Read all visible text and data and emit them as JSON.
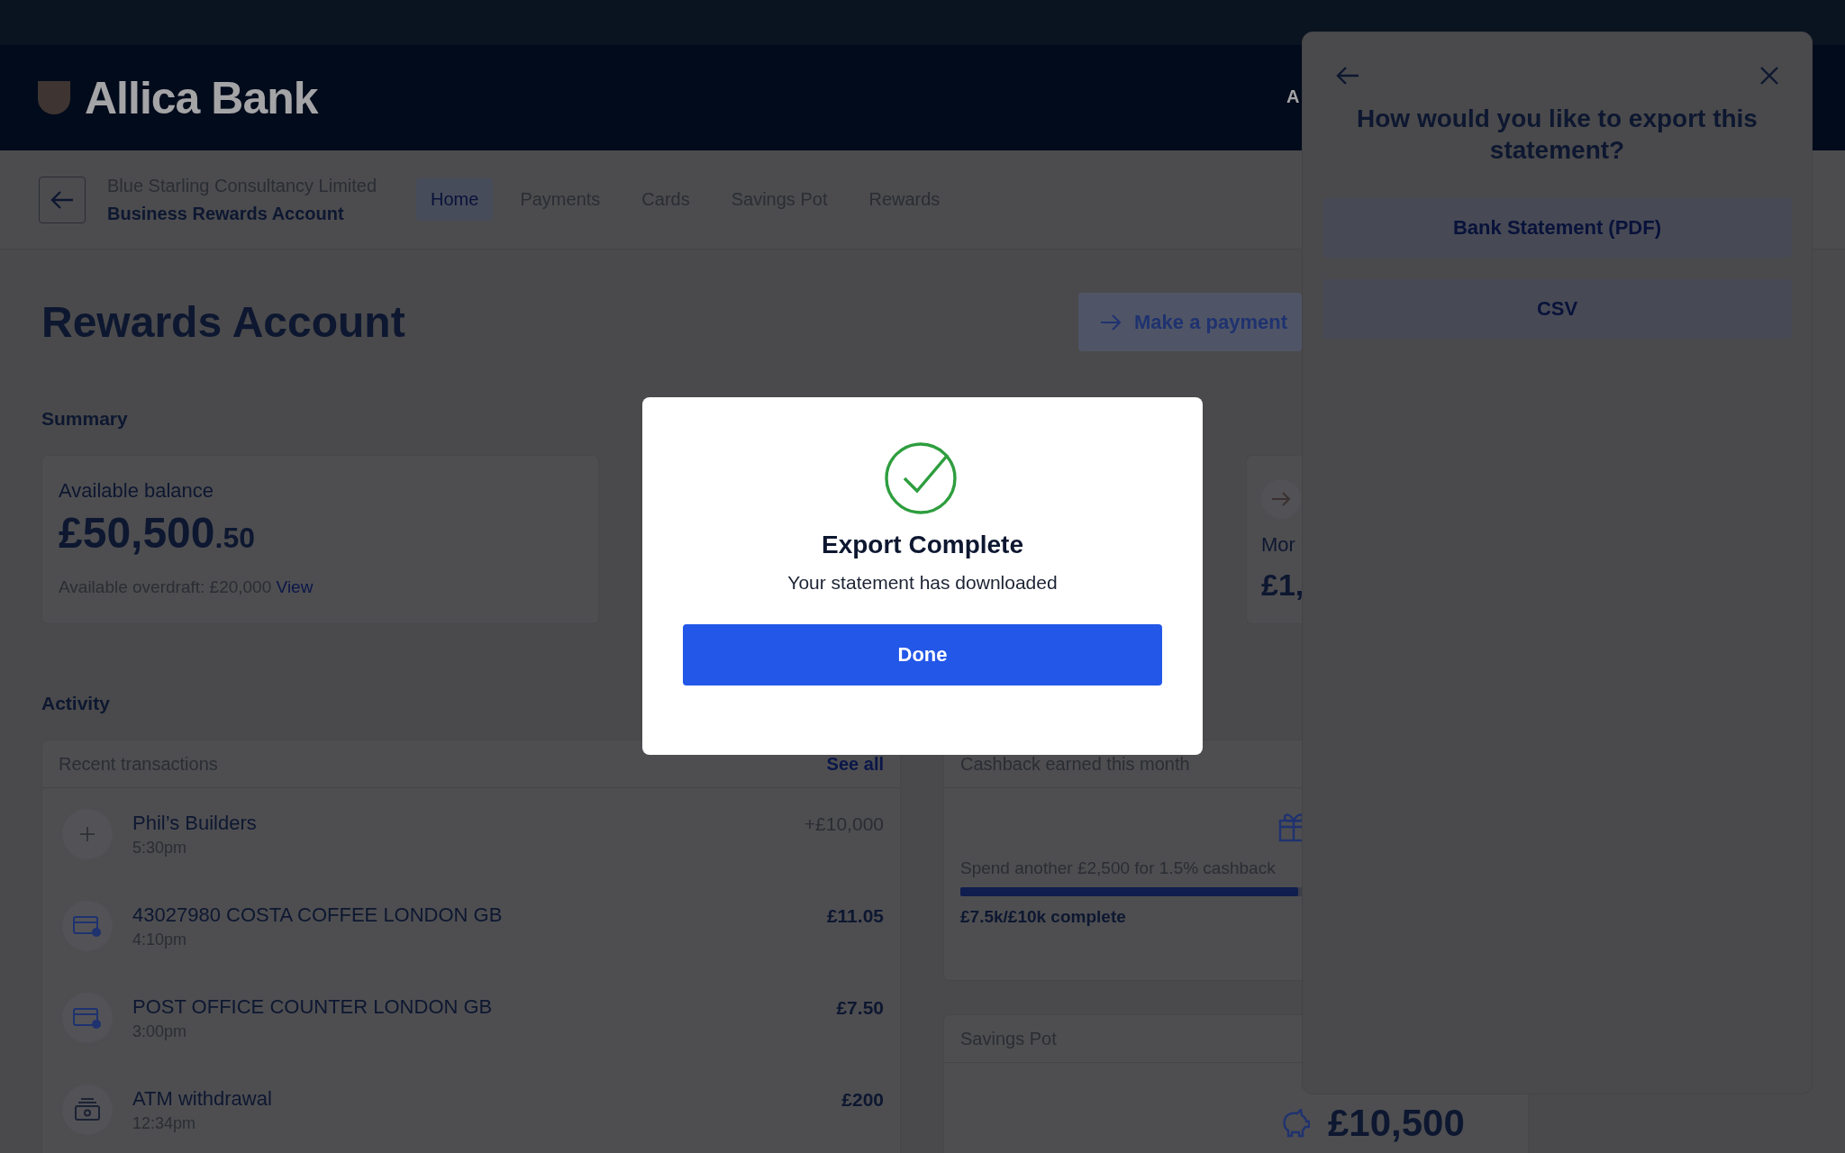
{
  "header": {
    "logo": "Allica Bank",
    "nav_partial": "A"
  },
  "account": {
    "organisation": "Blue Starling Consultancy Limited",
    "name": "Business Rewards Account"
  },
  "tabs": [
    {
      "label": "Home",
      "selected": true
    },
    {
      "label": "Payments",
      "selected": false
    },
    {
      "label": "Cards",
      "selected": false
    },
    {
      "label": "Savings Pot",
      "selected": false
    },
    {
      "label": "Rewards",
      "selected": false
    }
  ],
  "page_title": "Rewards Account",
  "make_payment": "Make a payment",
  "summary": {
    "title": "Summary",
    "balance": {
      "label": "Available balance",
      "amount_major": "£50,500",
      "amount_minor": ".50",
      "overdraft": "Available overdraft: £20,000",
      "link": "View"
    },
    "card_partial": {
      "label": "Mor",
      "amount": "£1,"
    }
  },
  "activity": {
    "title": "Activity",
    "transactions": {
      "title": "Recent transactions",
      "link": "See all",
      "rows": [
        {
          "kind": "credit",
          "name": "Phil’s Builders",
          "time": "5:30pm",
          "amount": "+£10,000"
        },
        {
          "kind": "card",
          "name": "43027980 COSTA COFFEE LONDON GB",
          "time": "4:10pm",
          "amount": "£11.05"
        },
        {
          "kind": "card",
          "name": "POST OFFICE COUNTER LONDON GB",
          "time": "3:00pm",
          "amount": "£7.50"
        },
        {
          "kind": "atm",
          "name": "ATM withdrawal",
          "time": "12:34pm",
          "amount": "£200"
        }
      ]
    },
    "cashback": {
      "title": "Cashback earned this month",
      "text": "Spend another £2,500 for 1.5% cashback",
      "level": 0.75,
      "progress": "£7.5k/£10k complete"
    },
    "savings_pot": {
      "title": "Savings Pot",
      "amount": "£10,500"
    }
  },
  "export_panel": {
    "title": "How would you like to export this statement?",
    "options": [
      "Bank Statement (PDF)",
      "CSV"
    ]
  },
  "dialog": {
    "title": "Export Complete",
    "message": "Your statement has downloaded",
    "button": "Done"
  }
}
